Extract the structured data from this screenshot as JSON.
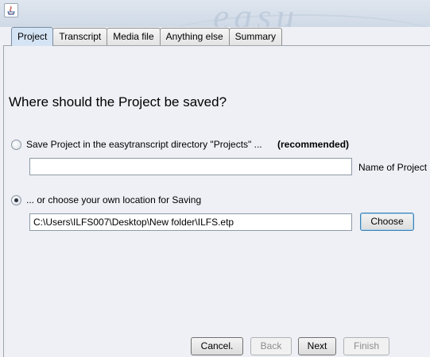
{
  "window": {
    "watermark_text": "easu"
  },
  "tabs": [
    {
      "label": "Project",
      "active": true
    },
    {
      "label": "Transcript",
      "active": false
    },
    {
      "label": "Media file",
      "active": false
    },
    {
      "label": "Anything else",
      "active": false
    },
    {
      "label": "Summary",
      "active": false
    }
  ],
  "main": {
    "heading": "Where should the Project be saved?",
    "option_default": {
      "label": "Save Project in the easytranscript directory \"Projects\" ...",
      "hint": "(recommended)",
      "checked": false,
      "name_field_value": "",
      "name_field_label": "Name of Project"
    },
    "option_custom": {
      "label": "... or choose your own location for Saving",
      "checked": true,
      "path_value": "C:\\Users\\ILFS007\\Desktop\\New folder\\ILFS.etp",
      "choose_label": "Choose"
    }
  },
  "footer": {
    "cancel_label": "Cancel.",
    "back_label": "Back",
    "next_label": "Next",
    "finish_label": "Finish"
  }
}
